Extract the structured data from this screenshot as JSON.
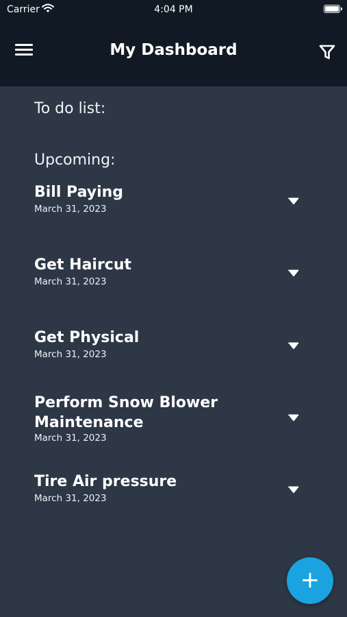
{
  "status_bar": {
    "carrier": "Carrier",
    "time": "4:04 PM"
  },
  "header": {
    "title": "My Dashboard"
  },
  "sections": {
    "todo_label": "To do list:",
    "upcoming_label": "Upcoming:"
  },
  "tasks": [
    {
      "name": "Bill Paying",
      "date": "March 31, 2023"
    },
    {
      "name": "Get Haircut",
      "date": "March 31, 2023"
    },
    {
      "name": "Get Physical",
      "date": "March 31, 2023"
    },
    {
      "name": "Perform Snow Blower Maintenance",
      "date": "March 31, 2023"
    },
    {
      "name": "Tire Air pressure",
      "date": "March 31, 2023"
    }
  ],
  "fab": {
    "label": "+"
  },
  "colors": {
    "background": "#2d3745",
    "header": "#111a24",
    "accent": "#1aa3e0"
  }
}
